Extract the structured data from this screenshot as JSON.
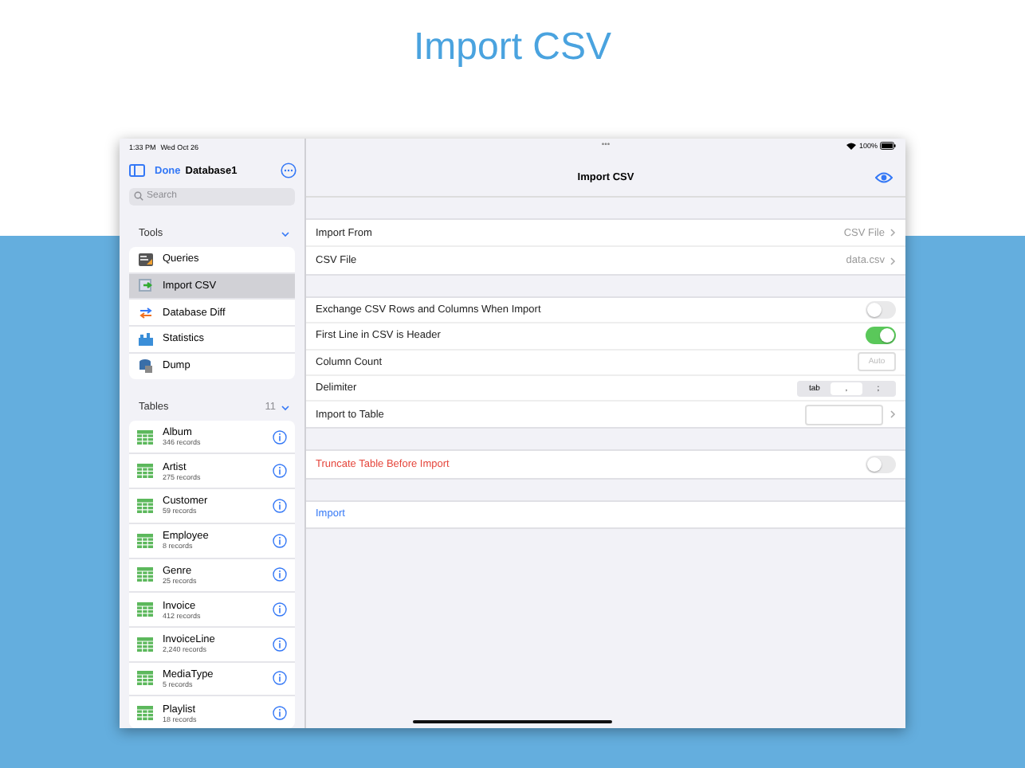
{
  "headline": "Import CSV",
  "status_bar": {
    "time": "1:33 PM",
    "date": "Wed Oct 26",
    "dots": "•••",
    "battery": "100%"
  },
  "sidebar": {
    "done": "Done",
    "title": "Database1",
    "search": {
      "placeholder": "Search"
    },
    "tools": {
      "title": "Tools",
      "expanded": true,
      "items": [
        {
          "kind": "queries",
          "label": "Queries",
          "selected": false
        },
        {
          "kind": "import",
          "label": "Import CSV",
          "selected": true
        },
        {
          "kind": "diff",
          "label": "Database Diff",
          "selected": false
        },
        {
          "kind": "statistics",
          "label": "Statistics",
          "selected": false
        },
        {
          "kind": "dump",
          "label": "Dump",
          "selected": false
        }
      ]
    },
    "tables": {
      "title": "Tables",
      "count": "11",
      "expanded": true,
      "items": [
        {
          "name": "Album",
          "records": "346 records"
        },
        {
          "name": "Artist",
          "records": "275 records"
        },
        {
          "name": "Customer",
          "records": "59 records"
        },
        {
          "name": "Employee",
          "records": "8 records"
        },
        {
          "name": "Genre",
          "records": "25 records"
        },
        {
          "name": "Invoice",
          "records": "412 records"
        },
        {
          "name": "InvoiceLine",
          "records": "2,240 records"
        },
        {
          "name": "MediaType",
          "records": "5 records"
        },
        {
          "name": "Playlist",
          "records": "18 records"
        }
      ]
    }
  },
  "main": {
    "title": "Import CSV",
    "groups": [
      [
        {
          "kind": "value",
          "label": "Import From",
          "value": "CSV File"
        },
        {
          "kind": "value",
          "label": "CSV File",
          "value": "data.csv"
        }
      ],
      [
        {
          "kind": "toggle",
          "label": "Exchange CSV Rows and Columns When Import",
          "on": false
        },
        {
          "kind": "toggle",
          "label": "First Line in CSV is Header",
          "on": true
        },
        {
          "kind": "field",
          "label": "Column Count",
          "placeholder": "Auto"
        },
        {
          "kind": "segmented",
          "label": "Delimiter",
          "options": [
            {
              "label": "tab",
              "selected": false
            },
            {
              "label": ",",
              "selected": true
            },
            {
              "label": ";",
              "selected": false
            }
          ]
        },
        {
          "kind": "picker",
          "label": "Import to Table"
        }
      ],
      [
        {
          "kind": "danger-toggle",
          "label": "Truncate Table Before Import",
          "on": false
        }
      ],
      [
        {
          "kind": "action",
          "label": "Import"
        }
      ]
    ]
  }
}
